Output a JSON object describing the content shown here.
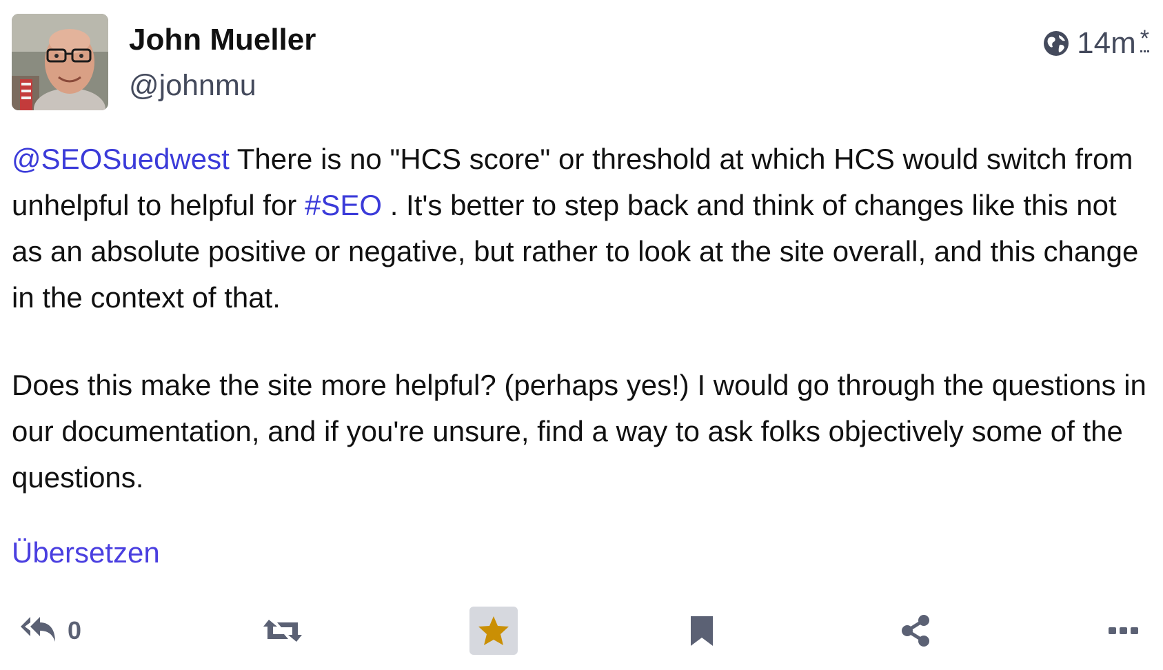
{
  "author": {
    "display_name": "John Mueller",
    "handle": "@johnmu",
    "avatar_icon": "profile-photo"
  },
  "meta": {
    "visibility_icon": "globe-icon",
    "timestamp": "14m",
    "edited_mark": "*"
  },
  "post": {
    "mention": "@SEOSuedwest",
    "text_part1": " There is no \"HCS score\" or threshold at which HCS would switch from unhelpful to helpful for ",
    "hashtag": "#SEO",
    "text_part2": " . It's better to step back and think of changes like this not as an absolute positive or negative, but rather to look at the site overall, and this change in the context of that.",
    "paragraph2": "Does this make the site more helpful? (perhaps yes!) I would go through the questions in our documentation, and if you're unsure, find a way to ask folks objectively some of the questions."
  },
  "translate_label": "Übersetzen",
  "actions": {
    "reply_icon": "reply-all-icon",
    "reply_count": "0",
    "boost_icon": "boost-icon",
    "favourite_icon": "star-icon",
    "favourite_active_color": "#ca8f04",
    "bookmark_icon": "bookmark-icon",
    "share_icon": "share-icon",
    "more_icon": "ellipsis-icon"
  },
  "colors": {
    "link": "#3b3bd9",
    "translate": "#4a3fe0",
    "muted": "#444a5c",
    "icon": "#5b6174"
  }
}
